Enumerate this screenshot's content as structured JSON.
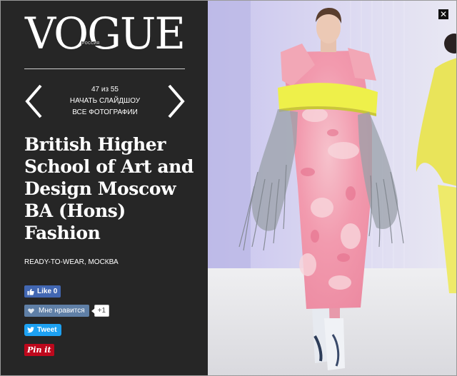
{
  "header": {
    "logo": "VOGUE",
    "logo_sub": "РОССИЯ"
  },
  "slideshow": {
    "counter": "47 из 55",
    "start_label": "НАЧАТЬ СЛАЙДШОУ",
    "all_photos_label": "ВСЕ ФОТОГРАФИИ",
    "prev_icon": "chevron-left-icon",
    "next_icon": "chevron-right-icon"
  },
  "collection": {
    "title": "British Higher School of Art and Design Moscow BA (Hons) Fashion",
    "subtitle": "READY-TO-WEAR, МОСКВА"
  },
  "social": {
    "facebook_label": "Like 0",
    "vk_label": "Мне нравится",
    "vk_count": "+1",
    "twitter_label": "Tweet",
    "pinterest_label": "Pin it"
  },
  "colors": {
    "panel_bg": "#262626",
    "facebook": "#4267b2",
    "vk": "#5f7fa6",
    "twitter": "#1da1f2",
    "pinterest": "#bd081c"
  },
  "close_icon": "close-icon"
}
